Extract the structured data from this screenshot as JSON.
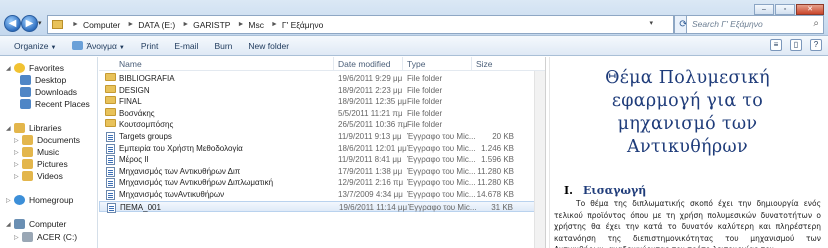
{
  "address_bar": {
    "segments": [
      "Computer",
      "DATA (E:)",
      "GARISTP",
      "Msc",
      "Γ' Εξάμηνο"
    ],
    "search_placeholder": "Search Γ' Εξάμηνο"
  },
  "window_controls": [
    "minimize",
    "maximize",
    "close"
  ],
  "toolbar": {
    "items": [
      "Organize",
      "Άνοιγμα",
      "Print",
      "E-mail",
      "Burn",
      "New folder"
    ]
  },
  "nav_pane": {
    "items": [
      {
        "label": "Favorites",
        "icon": "star-icon",
        "level": 0
      },
      {
        "label": "Desktop",
        "icon": "desktop-icon",
        "level": 1
      },
      {
        "label": "Downloads",
        "icon": "downloads-icon",
        "level": 1
      },
      {
        "label": "Recent Places",
        "icon": "recent-places-icon",
        "level": 1
      },
      {
        "label": "Libraries",
        "icon": "libraries-icon",
        "level": 0
      },
      {
        "label": "Documents",
        "icon": "documents-icon",
        "level": 1
      },
      {
        "label": "Music",
        "icon": "music-icon",
        "level": 1
      },
      {
        "label": "Pictures",
        "icon": "pictures-icon",
        "level": 1
      },
      {
        "label": "Videos",
        "icon": "videos-icon",
        "level": 1
      },
      {
        "label": "Homegroup",
        "icon": "homegroup-icon",
        "level": 0
      },
      {
        "label": "Computer",
        "icon": "computer-icon",
        "level": 0
      },
      {
        "label": "ACER (C:)",
        "icon": "drive-icon",
        "level": 1
      }
    ]
  },
  "file_list": {
    "columns": [
      "Name",
      "Date modified",
      "Type",
      "Size"
    ],
    "rows": [
      {
        "name": "BIBLIOGRAFIA",
        "date": "19/6/2011 9:29 μμ",
        "type": "File folder",
        "size": "",
        "kind": "folder"
      },
      {
        "name": "DESIGN",
        "date": "18/9/2011 2:23 μμ",
        "type": "File folder",
        "size": "",
        "kind": "folder"
      },
      {
        "name": "FINAL",
        "date": "18/9/2011 12:35 μμ",
        "type": "File folder",
        "size": "",
        "kind": "folder"
      },
      {
        "name": "Βοσνάκης",
        "date": "5/5/2011 11:21 πμ",
        "type": "File folder",
        "size": "",
        "kind": "folder"
      },
      {
        "name": "Κουτσομπόσης",
        "date": "26/5/2011 10:36 πμ",
        "type": "File folder",
        "size": "",
        "kind": "folder"
      },
      {
        "name": "Targets groups",
        "date": "11/9/2011 9:13 μμ",
        "type": "Έγγραφο του Mic...",
        "size": "20 KB",
        "kind": "doc"
      },
      {
        "name": "Εμπειρία του Χρήστη Μεθοδολογία",
        "date": "18/6/2011 12:01 μμ",
        "type": "Έγγραφο του Mic...",
        "size": "1.246 KB",
        "kind": "doc"
      },
      {
        "name": "Μέρος ΙΙ",
        "date": "11/9/2011 8:41 μμ",
        "type": "Έγγραφο του Mic...",
        "size": "1.596 KB",
        "kind": "doc"
      },
      {
        "name": "Μηχανισμός των Αντικυθήρων Διπ",
        "date": "17/9/2011 1:38 μμ",
        "type": "Έγγραφο του Mic...",
        "size": "11.280 KB",
        "kind": "doc"
      },
      {
        "name": "Μηχανισμός των Αντικυθήρων Διπλωματική",
        "date": "12/9/2011 2:16 πμ",
        "type": "Έγγραφο του Mic...",
        "size": "11.280 KB",
        "kind": "doc"
      },
      {
        "name": "Μηχανισμός τωνΑντικυθήρων",
        "date": "13/7/2009 4:34 μμ",
        "type": "Έγγραφο του Mic...",
        "size": "14.678 KB",
        "kind": "doc"
      },
      {
        "name": "ΠΕΜΑ_001",
        "date": "19/6/2011 11:14 μμ",
        "type": "Έγγραφο του Mic...",
        "size": "31 KB",
        "kind": "doc",
        "selected": true
      }
    ]
  },
  "preview": {
    "title": "Θέμα Πολυμεσική εφαρμογή για το μηχανισμό των Αντικυθήρων",
    "heading_number": "I.",
    "heading": "Εισαγωγή",
    "body": "Το θέμα της διπλωματικής σκοπό έχει την δημιουργία ενός τελικού προϊόντος όπου με τη χρήση πολυμεσικών δυνατοτήτων ο χρήστης θα έχει την κατά το δυνατόν καλύτερη και πληρέστερη κατανόηση της διεπιστημονικότητας του μηχανισμού των Αντικυθήρων, αναδεικνύοντας τον τρόπο λειτουργίας του."
  }
}
